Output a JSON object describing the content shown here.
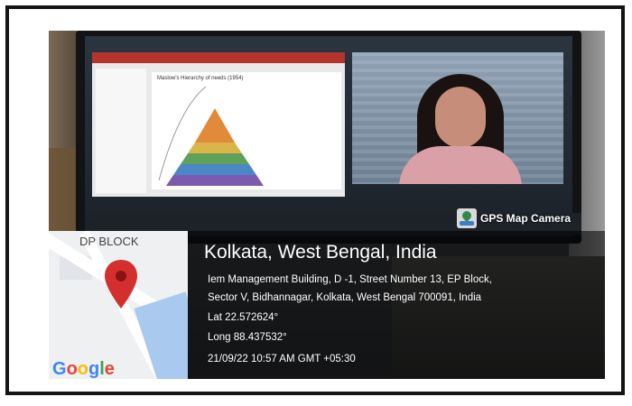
{
  "slide": {
    "title": "Maslow's Hierarchy of needs (1954)"
  },
  "badge": {
    "label": "GPS Map Camera",
    "icon": "gps-map-camera-icon"
  },
  "map": {
    "label": "DP BLOCK",
    "logo": "Google",
    "pin_icon": "map-pin-icon",
    "pin_color": "#d32f2f"
  },
  "location": {
    "title": "Kolkata, West Bengal, India",
    "address_line1": "Iem Management Building, D -1, Street Number 13, EP Block,",
    "address_line2": "Sector V, Bidhannagar, Kolkata, West Bengal 700091, India",
    "lat": "Lat 22.572624°",
    "long": "Long 88.437532°",
    "datetime": "21/09/22 10:57 AM GMT +05:30"
  },
  "colors": {
    "overlay": "#000000",
    "text": "#ffffff",
    "pin": "#d32f2f"
  }
}
